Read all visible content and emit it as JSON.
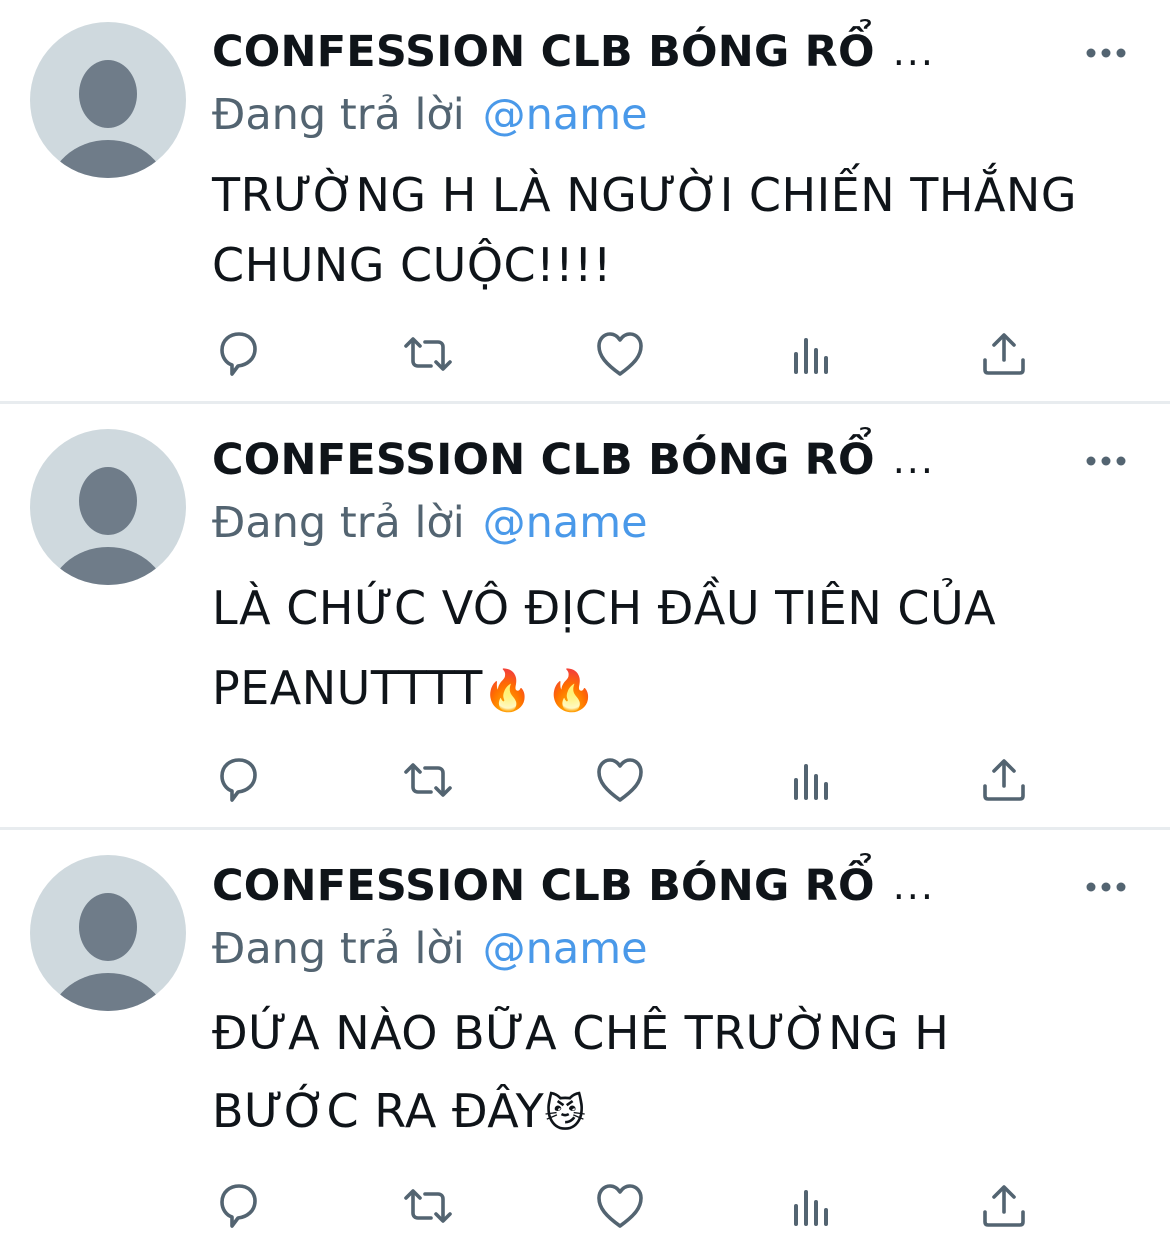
{
  "tweets": [
    {
      "author": "CONFESSION CLB BÓNG RỔ",
      "ellipsis": "...",
      "reply_prefix": "Đang trả lời",
      "reply_handle": "@name",
      "lines": [
        "TRƯỜNG H LÀ NGƯỜI CHIẾN THẮNG",
        "CHUNG CUỘC!!!!"
      ],
      "emoji": ""
    },
    {
      "author": "CONFESSION CLB BÓNG RỔ",
      "ellipsis": "...",
      "reply_prefix": "Đang trả lời",
      "reply_handle": "@name",
      "lines": [
        "LÀ CHỨC VÔ ĐỊCH ĐẦU TIÊN CỦA",
        "PEANUTTTT"
      ],
      "emoji": "🔥 🔥"
    },
    {
      "author": "CONFESSION CLB BÓNG RỔ",
      "ellipsis": "...",
      "reply_prefix": "Đang trả lời",
      "reply_handle": "@name",
      "lines": [
        "ĐỨA NÀO BỮA CHÊ TRƯỜNG H",
        "BƯỚC RA ĐÂY"
      ],
      "emoji": "😼"
    }
  ],
  "icons": {
    "avatar": "default-profile-icon",
    "more": "more-dots-icon",
    "reply": "reply-bubble-icon",
    "retweet": "retweet-icon",
    "like": "heart-icon",
    "views": "views-bar-chart-icon",
    "share": "share-upload-icon"
  },
  "colors": {
    "text": "#0f1419",
    "secondary": "#536471",
    "link": "#4a99e9",
    "avatar_bg": "#cfd9de",
    "avatar_fg": "#6f7c89",
    "divider": "#e8ecef"
  }
}
